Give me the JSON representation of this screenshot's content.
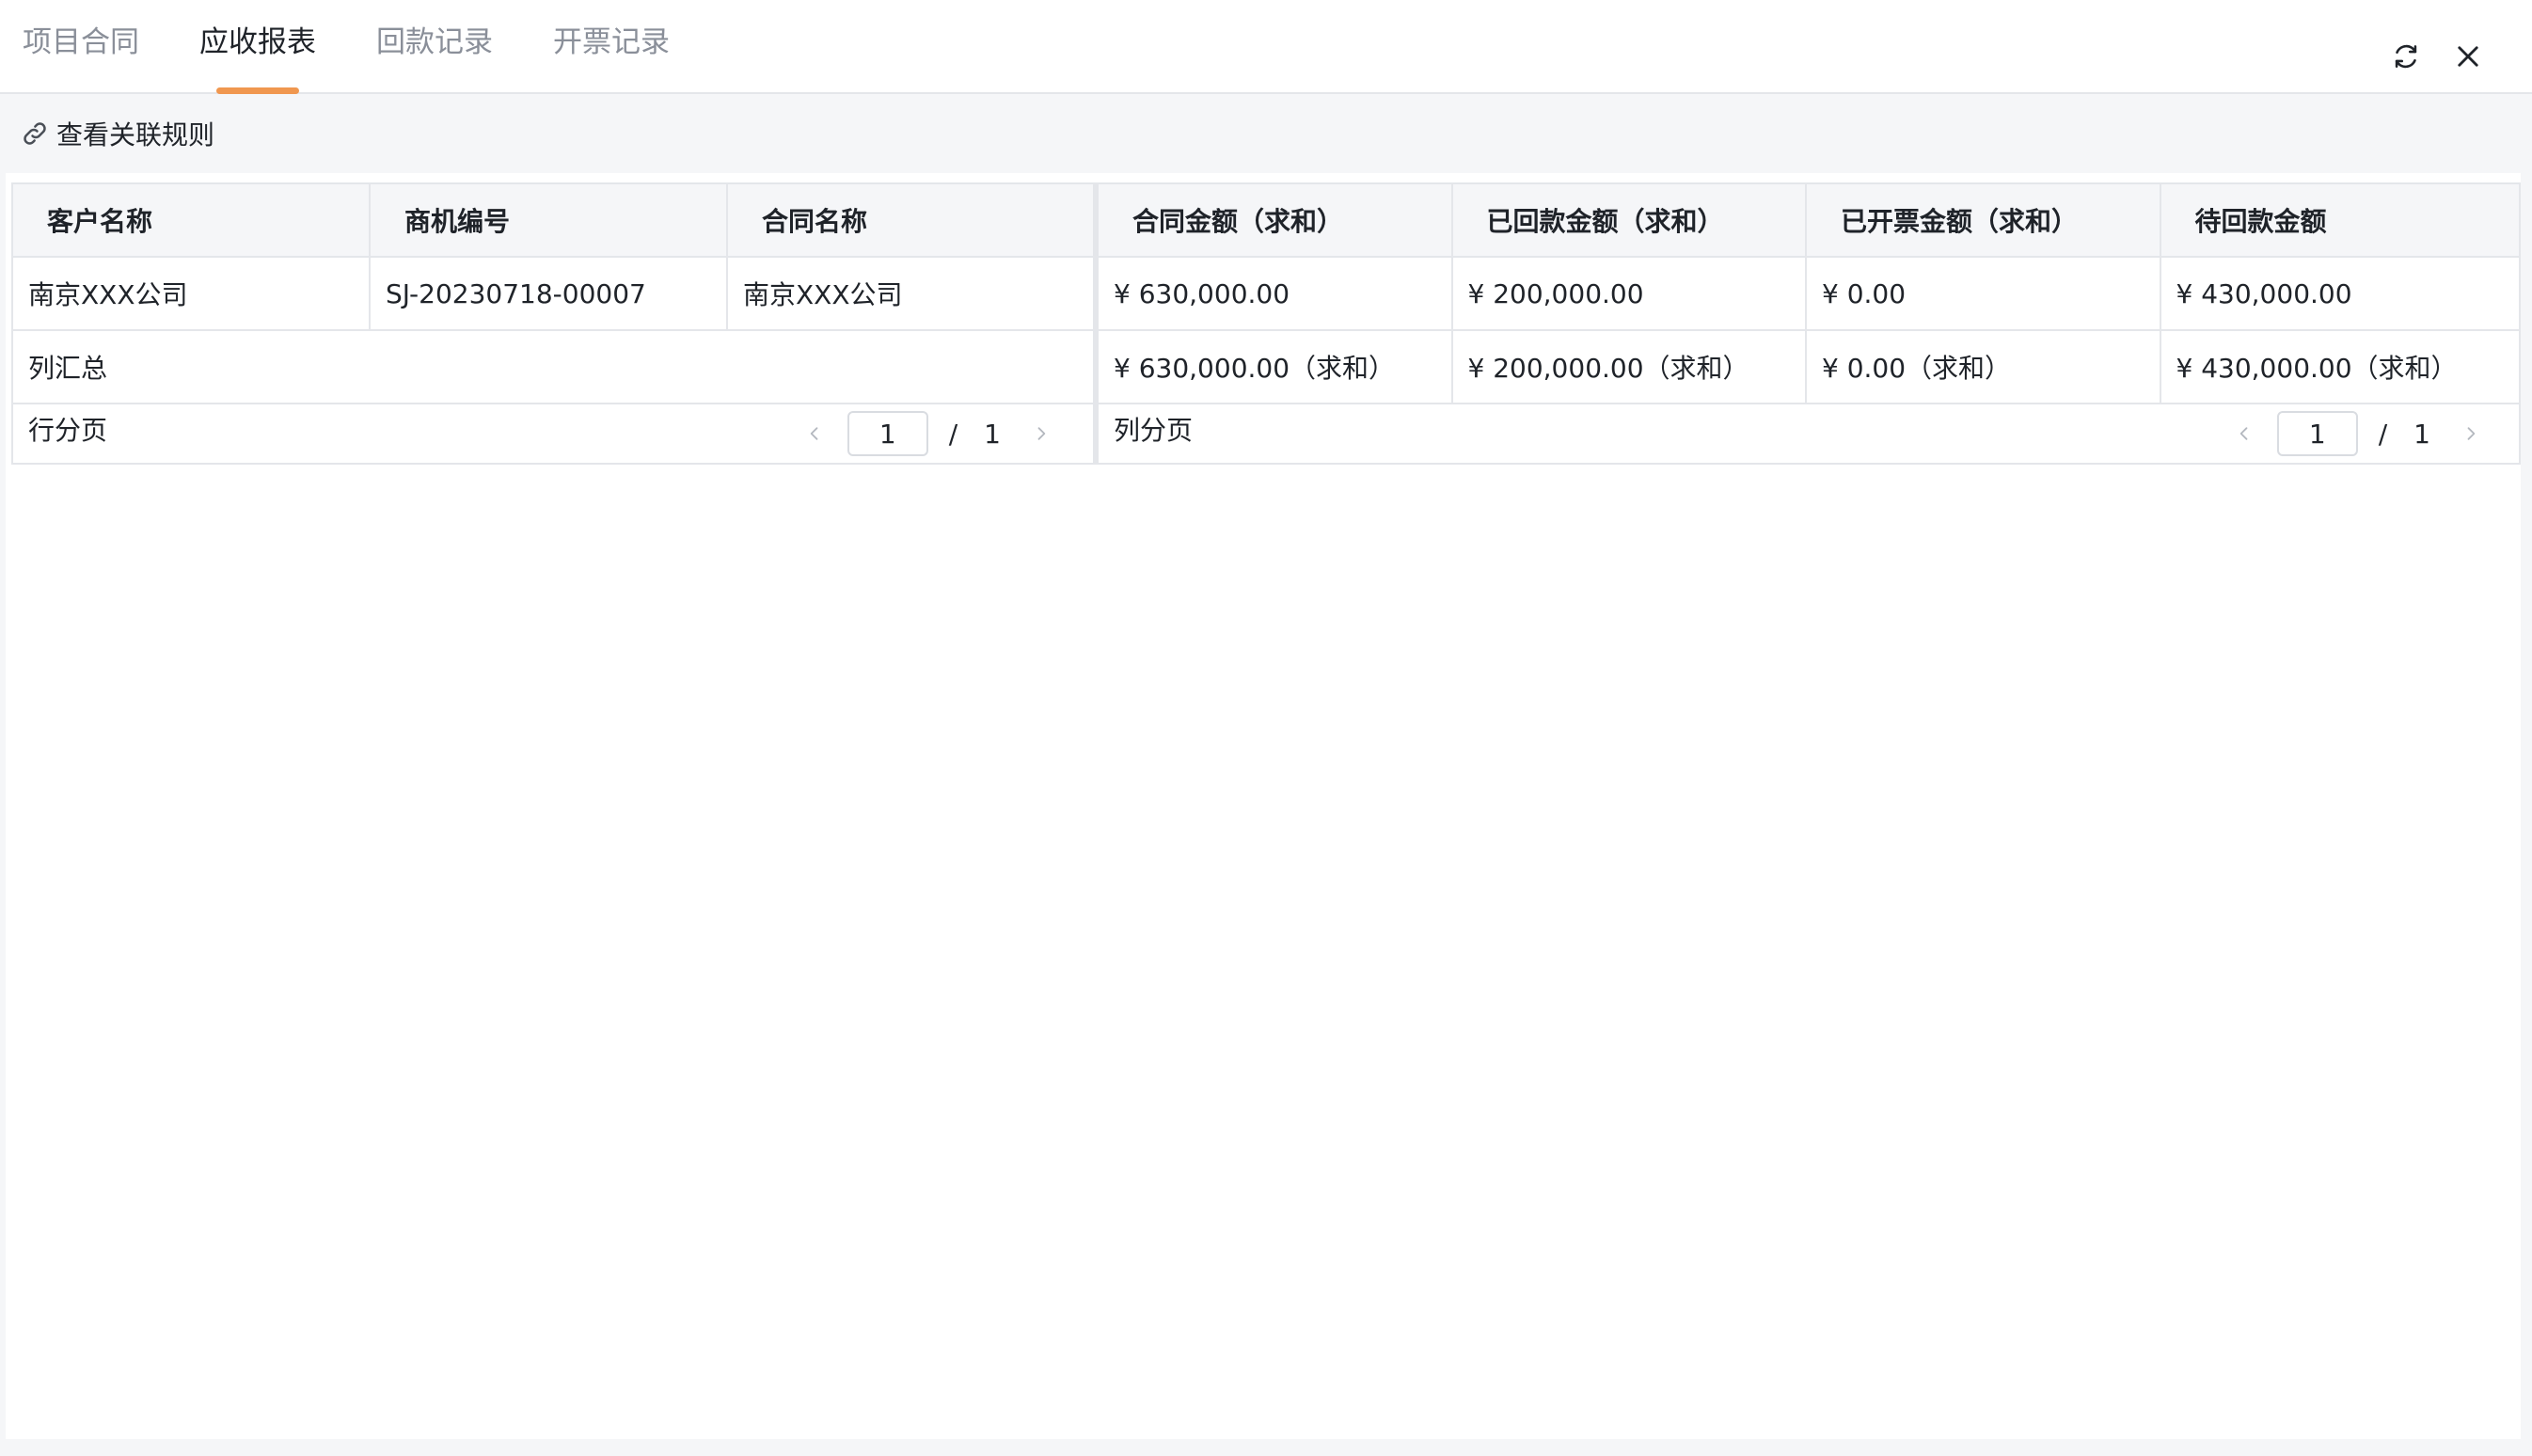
{
  "tabs": [
    {
      "label": "项目合同",
      "active": false
    },
    {
      "label": "应收报表",
      "active": true
    },
    {
      "label": "回款记录",
      "active": false
    },
    {
      "label": "开票记录",
      "active": false
    }
  ],
  "header": {
    "refresh_icon": "refresh-icon",
    "close_icon": "close-icon",
    "accent": "#f0974f"
  },
  "toolbar": {
    "rules_link_label": "查看关联规则",
    "rules_icon": "link-icon"
  },
  "table": {
    "row_headers": [
      "客户名称",
      "商机编号",
      "合同名称"
    ],
    "value_headers": [
      "合同金额（求和）",
      "已回款金额（求和）",
      "已开票金额（求和）",
      "待回款金额"
    ],
    "rows": [
      {
        "cells": [
          "南京XXX公司",
          "SJ-20230718-00007",
          "南京XXX公司"
        ],
        "values": [
          "¥ 630,000.00",
          "¥ 200,000.00",
          "¥ 0.00",
          "¥ 430,000.00"
        ]
      }
    ],
    "total": {
      "label": "列汇总",
      "values": [
        "¥ 630,000.00（求和）",
        "¥ 200,000.00（求和）",
        "¥ 0.00（求和）",
        "¥ 430,000.00（求和）"
      ]
    },
    "row_pager": {
      "label": "行分页",
      "current": "1",
      "separator": "/",
      "total": "1"
    },
    "col_pager": {
      "label": "列分页",
      "current": "1",
      "separator": "/",
      "total": "1"
    }
  }
}
